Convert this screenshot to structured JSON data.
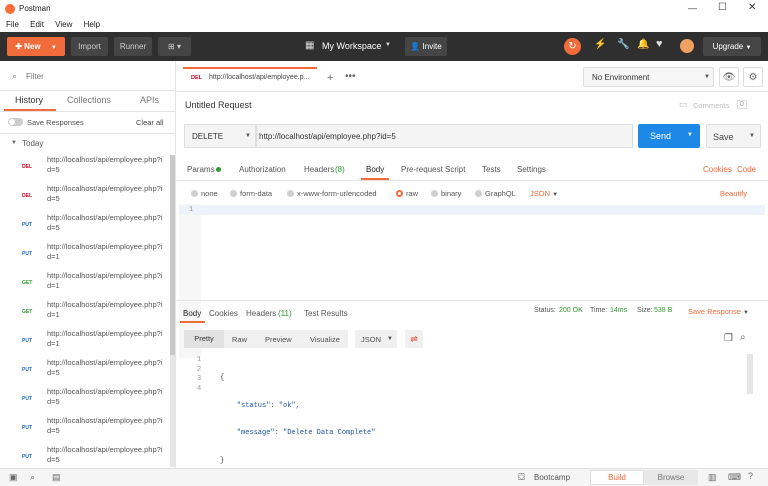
{
  "window": {
    "title": "Postman",
    "controls": [
      "—",
      "☐",
      "✕"
    ]
  },
  "menu": [
    "File",
    "Edit",
    "View",
    "Help"
  ],
  "header": {
    "new": "New",
    "import": "Import",
    "runner": "Runner",
    "workspace": "My Workspace",
    "invite": "Invite",
    "upgrade": "Upgrade"
  },
  "sidebar": {
    "filter_placeholder": "Filter",
    "tabs": [
      "History",
      "Collections",
      "APIs"
    ],
    "save_responses": "Save Responses",
    "clear_all": "Clear all",
    "group": "Today",
    "items": [
      {
        "method": "DEL",
        "color": "#d0021b",
        "url": "http://localhost/api/employee.php?id=5"
      },
      {
        "method": "DEL",
        "color": "#d0021b",
        "url": "http://localhost/api/employee.php?id=5"
      },
      {
        "method": "PUT",
        "color": "#1f6dc4",
        "url": "http://localhost/api/employee.php?id=5"
      },
      {
        "method": "PUT",
        "color": "#1f6dc4",
        "url": "http://localhost/api/employee.php?id=1"
      },
      {
        "method": "GET",
        "color": "#2f9a2f",
        "url": "http://localhost/api/employee.php?id=1"
      },
      {
        "method": "GET",
        "color": "#2f9a2f",
        "url": "http://localhost/api/employee.php?id=1"
      },
      {
        "method": "PUT",
        "color": "#1f6dc4",
        "url": "http://localhost/api/employee.php?id=1"
      },
      {
        "method": "PUT",
        "color": "#1f6dc4",
        "url": "http://localhost/api/employee.php?id=5"
      },
      {
        "method": "PUT",
        "color": "#1f6dc4",
        "url": "http://localhost/api/employee.php?id=5"
      },
      {
        "method": "PUT",
        "color": "#1f6dc4",
        "url": "http://localhost/api/employee.php?id=5"
      },
      {
        "method": "PUT",
        "color": "#1f6dc4",
        "url": "http://localhost/api/employee.php?id=5"
      }
    ]
  },
  "request": {
    "tab_method": "DEL",
    "tab_url": "http://localhost/api/employee.p...",
    "environment": "No Environment",
    "name": "Untitled Request",
    "comments": "Comments",
    "comments_count": "0",
    "method": "DELETE",
    "url": "http://localhost/api/employee.php?id=5",
    "send": "Send",
    "save": "Save",
    "tabs": [
      "Params",
      "Authorization",
      "Headers",
      "Body",
      "Pre-request Script",
      "Tests",
      "Settings"
    ],
    "headers_count": "(8)",
    "cookies": "Cookies",
    "code": "Code",
    "body_types": [
      "none",
      "form-data",
      "x-www-form-urlencoded",
      "raw",
      "binary",
      "GraphQL"
    ],
    "format": "JSON",
    "beautify": "Beautify",
    "line": "1"
  },
  "response": {
    "tabs": [
      "Body",
      "Cookies",
      "Headers",
      "Test Results"
    ],
    "headers_count": "(11)",
    "status_label": "Status:",
    "status": "200 OK",
    "time_label": "Time:",
    "time": "14ms",
    "size_label": "Size:",
    "size": "538 B",
    "save_response": "Save Response",
    "views": [
      "Pretty",
      "Raw",
      "Preview",
      "Visualize"
    ],
    "format": "JSON",
    "lines": [
      "1",
      "2",
      "3",
      "4"
    ],
    "code": [
      "{",
      "    \"status\": \"ok\",",
      "    \"message\": \"Delete Data Complete\"",
      "}"
    ]
  },
  "statusbar": {
    "bootcamp": "Bootcamp",
    "build": "Build",
    "browse": "Browse"
  }
}
